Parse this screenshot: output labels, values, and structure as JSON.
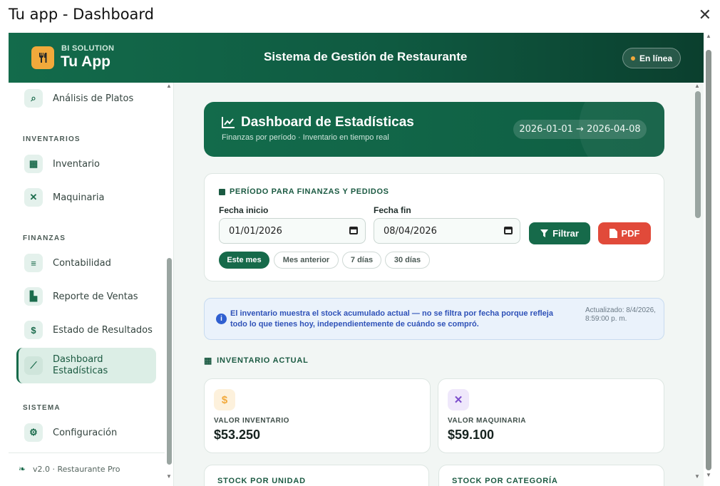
{
  "window": {
    "title": "Tu app - Dashboard",
    "close_icon": "close-icon"
  },
  "header": {
    "brand_small": "BI SOLUTION",
    "brand_big": "Tu App",
    "title": "Sistema de Gestión de Restaurante",
    "status": "En línea"
  },
  "sidebar": {
    "items": [
      {
        "label": "Análisis de Platos",
        "icon": "search-chart-icon"
      },
      {
        "label": "Inventario",
        "icon": "boxes-icon"
      },
      {
        "label": "Maquinaria",
        "icon": "tools-icon"
      },
      {
        "label": "Contabilidad",
        "icon": "coins-icon"
      },
      {
        "label": "Reporte de Ventas",
        "icon": "bar-chart-icon"
      },
      {
        "label": "Estado de Resultados",
        "icon": "dollar-icon"
      },
      {
        "label": "Dashboard Estadísticas",
        "icon": "line-chart-icon",
        "active": true
      },
      {
        "label": "Configuración",
        "icon": "gear-icon"
      }
    ],
    "sections": {
      "inventarios": "INVENTARIOS",
      "finanzas": "FINANZAS",
      "sistema": "SISTEMA"
    },
    "footer": "v2.0 · Restaurante Pro"
  },
  "hero": {
    "title": "Dashboard de Estadísticas",
    "subtitle": "Finanzas por período · Inventario en tiempo real",
    "range": "2026-01-01 → 2026-04-08"
  },
  "filter": {
    "title": "PERÍODO PARA FINANZAS Y PEDIDOS",
    "start_label": "Fecha inicio",
    "start_value": "01/01/2026",
    "end_label": "Fecha fin",
    "end_value": "08/04/2026",
    "filter_button": "Filtrar",
    "pdf_button": "PDF",
    "chips": [
      "Este mes",
      "Mes anterior",
      "7 días",
      "30 días"
    ]
  },
  "info": {
    "message": "El inventario muestra el stock acumulado actual — no se filtra por fecha porque refleja todo lo que tienes hoy, independientemente de cuándo se compró.",
    "updated": "Actualizado: 8/4/2026, 8:59:00 p. m."
  },
  "inventory": {
    "section_title": "INVENTARIO ACTUAL",
    "kpis": [
      {
        "label": "VALOR INVENTARIO",
        "value": "$53.250",
        "icon": "dollar-icon",
        "color": "#f2a93b"
      },
      {
        "label": "VALOR MAQUINARIA",
        "value": "$59.100",
        "icon": "tools-icon",
        "color": "#7c4dcc"
      }
    ],
    "bottom_cards": [
      "STOCK POR UNIDAD",
      "STOCK POR CATEGORÍA"
    ]
  }
}
